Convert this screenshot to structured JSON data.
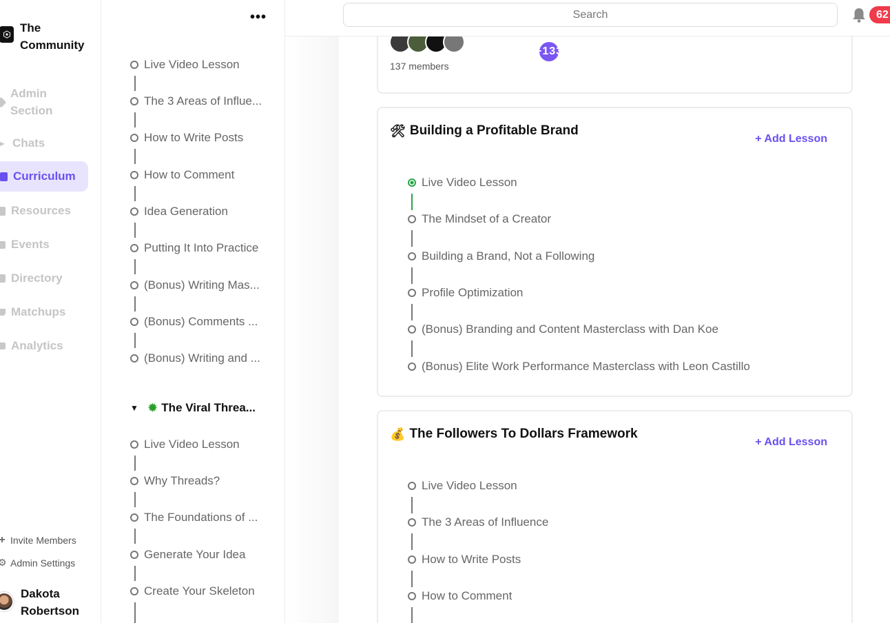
{
  "brand": {
    "name": "The Community"
  },
  "nav": {
    "items": [
      {
        "label": "Admin Section",
        "icon": "tag-icon"
      },
      {
        "label": "Chats",
        "icon": "send-icon"
      },
      {
        "label": "Curriculum",
        "icon": "book-icon",
        "active": true
      },
      {
        "label": "Resources",
        "icon": "file-icon"
      },
      {
        "label": "Events",
        "icon": "calendar-icon"
      },
      {
        "label": "Directory",
        "icon": "contacts-icon"
      },
      {
        "label": "Matchups",
        "icon": "coffee-icon"
      },
      {
        "label": "Analytics",
        "icon": "chart-icon"
      }
    ],
    "invite": "Invite Members",
    "settings": "Admin Settings",
    "user": "Dakota Robertson"
  },
  "outline": {
    "more": "•••",
    "lessons_top": [
      "Live Video Lesson",
      "The 3 Areas of Influe...",
      "How to Write Posts",
      "How to Comment",
      "Idea Generation",
      "Putting It Into Practice",
      "(Bonus) Writing Mas...",
      "(Bonus) Comments ...",
      "(Bonus) Writing and ..."
    ],
    "section": "The Viral Threa...",
    "lessons_bottom": [
      "Live Video Lesson",
      "Why Threads?",
      "The Foundations of ...",
      "Generate Your Idea",
      "Create Your Skeleton"
    ]
  },
  "topbar": {
    "search_placeholder": "Search",
    "notifications": "62"
  },
  "members": {
    "more": "+133",
    "text": "137 members"
  },
  "modules": [
    {
      "emoji": "🛠",
      "title": "Building a Profitable Brand",
      "add": "+ Add Lesson",
      "lessons": [
        "Live Video Lesson",
        "The Mindset of a Creator",
        "Building a Brand, Not a Following",
        "Profile Optimization",
        "(Bonus) Branding and Content Masterclass with Dan Koe",
        "(Bonus) Elite Work Performance Masterclass with Leon Castillo"
      ]
    },
    {
      "emoji": "💰",
      "title": "The Followers To Dollars Framework",
      "add": "+ Add Lesson",
      "lessons": [
        "Live Video Lesson",
        "The 3 Areas of Influence",
        "How to Write Posts",
        "How to Comment"
      ]
    }
  ],
  "colors": {
    "accent": "#6a4ff0",
    "done": "#2aa44a",
    "badge": "#ef3b4a"
  }
}
